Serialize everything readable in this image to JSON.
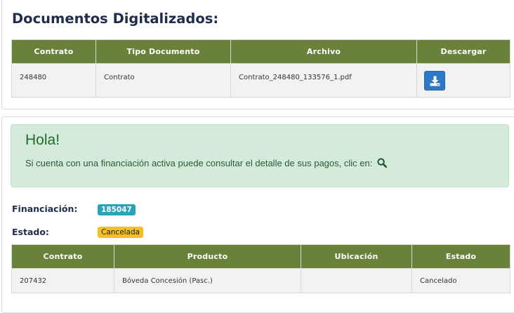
{
  "docs_section": {
    "title": "Documentos Digitalizados:",
    "columns": [
      "Contrato",
      "Tipo Documento",
      "Archivo",
      "Descargar"
    ],
    "rows": [
      {
        "contrato": "248480",
        "tipo": "Contrato",
        "archivo": "Contrato_248480_133576_1.pdf"
      }
    ],
    "download_icon": "download-icon",
    "accent_color": "#6a813b"
  },
  "alert": {
    "heading": "Hola!",
    "message": "Si cuenta con una financiación activa puede consultar el detalle de sus pagos, clic en:",
    "icon": "search-icon"
  },
  "financing": {
    "label": "Financiación:",
    "value": "185047",
    "status_label": "Estado:",
    "status_value": "Cancelada",
    "columns": [
      "Contrato",
      "Producto",
      "Ubicación",
      "Estado"
    ],
    "rows": [
      {
        "contrato": "207432",
        "producto": "Bóveda Concesión (Pasc.)",
        "ubicacion": "",
        "estado": "Cancelado"
      }
    ]
  }
}
